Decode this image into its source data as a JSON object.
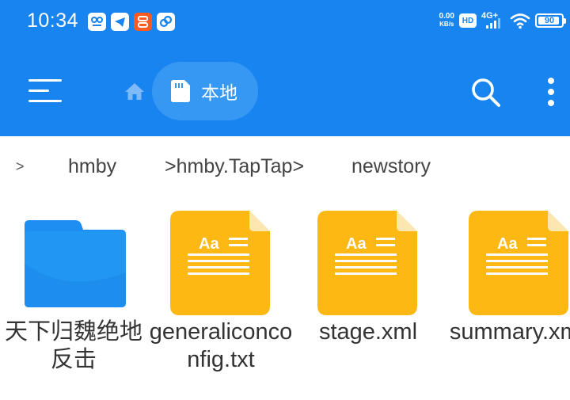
{
  "status_bar": {
    "time": "10:34",
    "net_speed_value": "0.00",
    "net_speed_unit": "KB/s",
    "hd_label": "HD",
    "network_type": "4G+",
    "battery_level": "90",
    "notification_icons": [
      "video-editor-icon",
      "telegram-icon",
      "video-app-icon",
      "link-app-icon"
    ]
  },
  "toolbar": {
    "location_label": "本地",
    "accent_color": "#1784f0",
    "pill_color": "#3798f4"
  },
  "breadcrumb": {
    "items": [
      ">",
      "hmby",
      ">hmby.TapTap>",
      "newstory"
    ]
  },
  "files": [
    {
      "name": "天下归魏绝地反击",
      "type": "folder",
      "icon": "folder-icon",
      "color": "#1e8ef2"
    },
    {
      "name": "generaliconconfig.txt",
      "type": "document",
      "icon": "document-icon",
      "color": "#fdb813"
    },
    {
      "name": "stage.xml",
      "type": "document",
      "icon": "document-icon",
      "color": "#fdb813"
    },
    {
      "name": "summary.xml",
      "type": "document",
      "icon": "document-icon",
      "color": "#fdb813"
    }
  ]
}
